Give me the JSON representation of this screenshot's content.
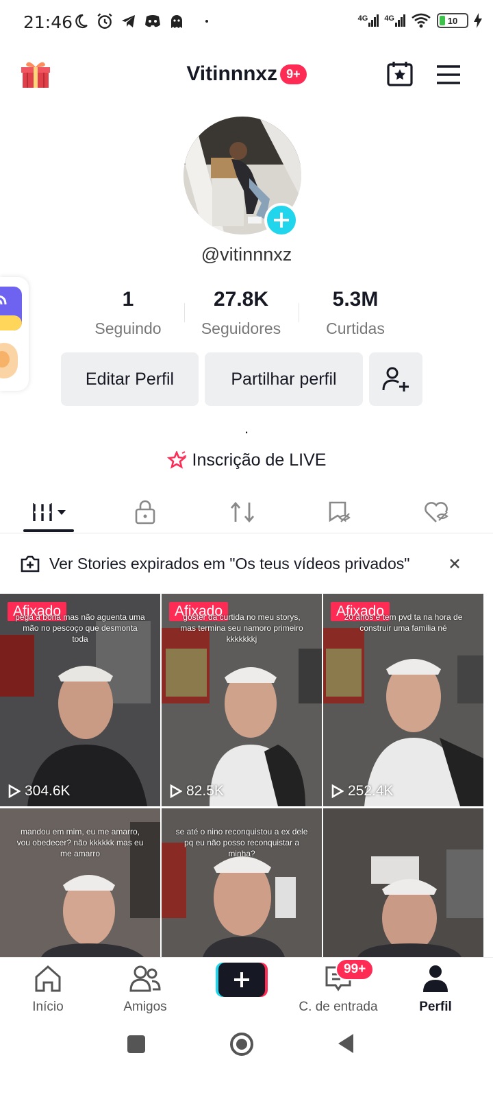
{
  "status_bar": {
    "time": "21:46",
    "net1": "4G",
    "net2": "4G",
    "battery": "10"
  },
  "header": {
    "username": "Vitinnnxz",
    "notification_badge": "9+"
  },
  "profile": {
    "handle": "@vitinnnxz",
    "stats": [
      {
        "value": "1",
        "label": "Seguindo"
      },
      {
        "value": "27.8K",
        "label": "Seguidores"
      },
      {
        "value": "5.3M",
        "label": "Curtidas"
      }
    ],
    "edit_label": "Editar Perfil",
    "share_label": "Partilhar perfil",
    "bio": ".",
    "live_label": "Inscrição de LIVE"
  },
  "banner": {
    "text": "Ver Stories expirados em \"Os teus vídeos privados\""
  },
  "videos": [
    {
      "pinned": "Afixado",
      "caption": "pega a bona mas não aguenta uma mão no pescoço que desmonta toda",
      "views": "304.6K"
    },
    {
      "pinned": "Afixado",
      "caption": "goster da curtida no meu storys, mas termina seu namoro primeiro kkkkkkkj",
      "views": "82.5K"
    },
    {
      "pinned": "Afixado",
      "caption": "20 anos e tem pvd ta na hora de construir uma familia né",
      "views": "252.4K"
    },
    {
      "pinned": "",
      "caption": "mandou em mim, eu me amarro, vou obedecer? não kkkkkk mas eu me amarro",
      "views": ""
    },
    {
      "pinned": "",
      "caption": "se até o nino reconquistou a ex dele pq eu não posso reconquistar a minha?",
      "views": ""
    },
    {
      "pinned": "",
      "caption": "",
      "views": ""
    }
  ],
  "bottom_nav": {
    "home": "Início",
    "friends": "Amigos",
    "inbox": "C. de entrada",
    "inbox_badge": "99+",
    "profile": "Perfil"
  },
  "colors": {
    "accent": "#fe2c55",
    "cyan": "#20d5ec",
    "button_bg": "#eeeff0"
  }
}
